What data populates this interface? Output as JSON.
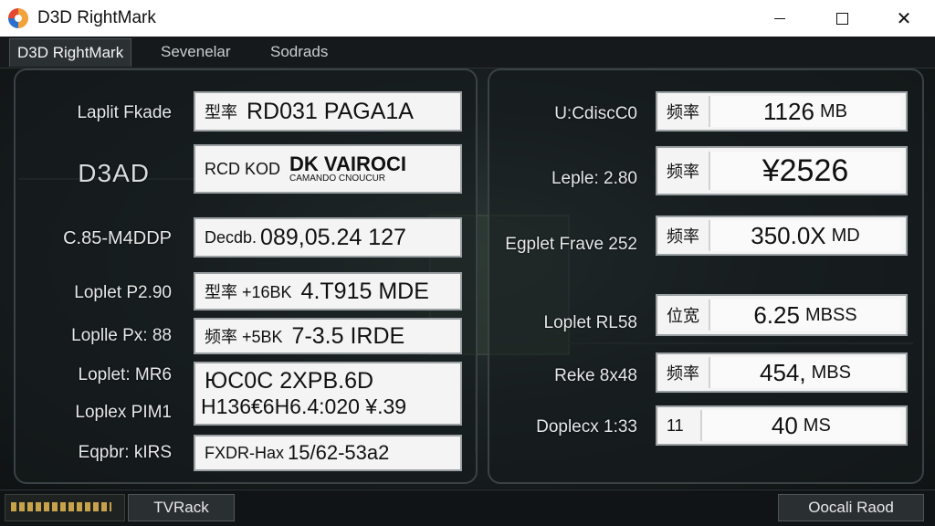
{
  "window": {
    "title": "D3D RightMark"
  },
  "tabs": [
    {
      "label": "D3D RightMark",
      "active": true
    },
    {
      "label": "Sevenelar",
      "active": false
    },
    {
      "label": "Sodrads",
      "active": false
    }
  ],
  "left_rows": [
    {
      "label": "Laplit Fkade",
      "prefix": "型率",
      "value": "RD031  PAGA1A"
    },
    {
      "label": "D3AD",
      "prefix": "RCD KOD",
      "value": "DK VAIROCI",
      "subvalue": "CAMANDO CNOUCUR"
    },
    {
      "label": "C.85-M4DDP",
      "prefix": "Decdb.",
      "value": "089,05.24 127"
    },
    {
      "label": "Loplet P2.90",
      "prefix": "型率 +16BK",
      "value": "4.T915  MDE"
    },
    {
      "label": "Loplle Px: 88",
      "prefix": "频率 +5BK",
      "value": "7-3.5  IRDE"
    },
    {
      "label": "Loplet: MR6",
      "prefix": "",
      "value": "ЮC0C  2XPB.6D"
    },
    {
      "label": "Loplex PIM1",
      "prefix": "",
      "value": "H136€6H6.4:020 ¥.39"
    },
    {
      "label": "Eqpbr: kIRS",
      "prefix": "FXDR-Нax",
      "value": "15/62-53a2"
    }
  ],
  "right_rows": [
    {
      "label": "U:CdiscC0",
      "prefix": "频率",
      "value": "1126",
      "unit": "MB"
    },
    {
      "label": "Leple: 2.80",
      "prefix": "频率",
      "value": "¥2526",
      "unit": ""
    },
    {
      "label": "Egplet Frave 252",
      "prefix": "频率",
      "value": "350.0X",
      "unit": "MD"
    },
    {
      "label": "Loplet RL58",
      "prefix": "位宽",
      "value": "6.25",
      "unit": "MBSS"
    },
    {
      "label": "Reke 8x48",
      "prefix": "频率",
      "value": "454,",
      "unit": "MBS"
    },
    {
      "label": "Doplecx 1:33",
      "prefix": "11",
      "value": "40",
      "unit": "MS"
    }
  ],
  "footer": {
    "left_button": "TVRack",
    "right_button": "Oocali Raod"
  },
  "colors": {
    "accent": "#f2a23a",
    "panel_border": "#3a4245",
    "box_bg": "#f4f4f4"
  }
}
